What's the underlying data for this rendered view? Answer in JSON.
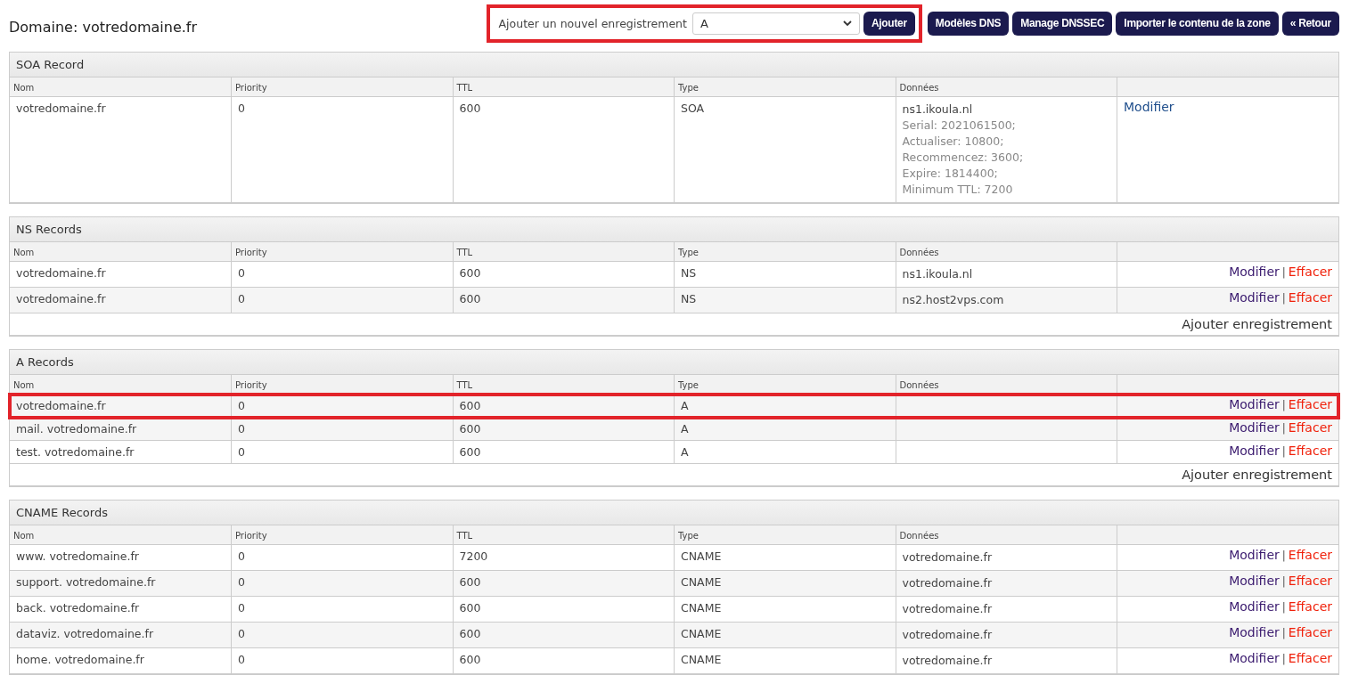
{
  "title": "Domaine: votredomaine.fr",
  "add_record": {
    "label": "Ajouter un nouvel enregistrement",
    "type_value": "A",
    "highlighted": true,
    "button": "Ajouter"
  },
  "buttons": [
    "Modèles DNS",
    "Manage DNSSEC",
    "Importer le contenu de la zone",
    "« Retour"
  ],
  "sections": [
    {
      "title": "SOA Record",
      "columns": [
        "Nom",
        "Priority",
        "TTL",
        "Type",
        "Données"
      ],
      "rows": [
        {
          "cells": [
            "votredomaine.fr",
            "0",
            "600",
            "SOA"
          ],
          "data": [
            "ns1.ikoula.nl",
            "Serial: 2021061500;",
            "Actualiser: 10800;",
            "Recommencez: 3600;",
            "Expire: 1814400;",
            "Minimum TTL: 7200"
          ],
          "highlighted": false,
          "actions": {
            "kind": "edit_only",
            "edit": "Modifier"
          }
        }
      ]
    },
    {
      "title": "NS Records",
      "columns": [
        "Nom",
        "Priority",
        "TTL",
        "Type",
        "Données"
      ],
      "footer_link": "Ajouter enregistrement",
      "rows": [
        {
          "cells": [
            "votredomaine.fr",
            "0",
            "600",
            "NS"
          ],
          "data": [
            "ns1.ikoula.nl"
          ],
          "highlighted": false,
          "actions": {
            "kind": "edit_delete",
            "edit": "Modifier",
            "sep": "|",
            "delete": "Effacer"
          }
        },
        {
          "cells": [
            "votredomaine.fr",
            "0",
            "600",
            "NS"
          ],
          "data": [
            "ns2.host2vps.com"
          ],
          "highlighted": false,
          "actions": {
            "kind": "edit_delete",
            "edit": "Modifier",
            "sep": "|",
            "delete": "Effacer"
          }
        }
      ]
    },
    {
      "title": "A Records",
      "columns": [
        "Nom",
        "Priority",
        "TTL",
        "Type",
        "Données"
      ],
      "footer_link": "Ajouter enregistrement",
      "rows": [
        {
          "cells": [
            "votredomaine.fr",
            "0",
            "600",
            "A"
          ],
          "data": [],
          "highlighted": true,
          "actions": {
            "kind": "edit_delete",
            "edit": "Modifier",
            "sep": "|",
            "delete": "Effacer"
          }
        },
        {
          "cells": [
            "mail. votredomaine.fr",
            "0",
            "600",
            "A"
          ],
          "data": [],
          "highlighted": false,
          "actions": {
            "kind": "edit_delete",
            "edit": "Modifier",
            "sep": "|",
            "delete": "Effacer"
          }
        },
        {
          "cells": [
            "test. votredomaine.fr",
            "0",
            "600",
            "A"
          ],
          "data": [],
          "highlighted": false,
          "actions": {
            "kind": "edit_delete",
            "edit": "Modifier",
            "sep": "|",
            "delete": "Effacer"
          }
        }
      ]
    },
    {
      "title": "CNAME Records",
      "columns": [
        "Nom",
        "Priority",
        "TTL",
        "Type",
        "Données"
      ],
      "rows": [
        {
          "cells": [
            "www. votredomaine.fr",
            "0",
            "7200",
            "CNAME"
          ],
          "data": [
            "votredomaine.fr"
          ],
          "highlighted": false,
          "actions": {
            "kind": "edit_delete",
            "edit": "Modifier",
            "sep": "|",
            "delete": "Effacer"
          }
        },
        {
          "cells": [
            "support. votredomaine.fr",
            "0",
            "600",
            "CNAME"
          ],
          "data": [
            "votredomaine.fr"
          ],
          "highlighted": false,
          "actions": {
            "kind": "edit_delete",
            "edit": "Modifier",
            "sep": "|",
            "delete": "Effacer"
          }
        },
        {
          "cells": [
            "back. votredomaine.fr",
            "0",
            "600",
            "CNAME"
          ],
          "data": [
            "votredomaine.fr"
          ],
          "highlighted": false,
          "actions": {
            "kind": "edit_delete",
            "edit": "Modifier",
            "sep": "|",
            "delete": "Effacer"
          }
        },
        {
          "cells": [
            "dataviz. votredomaine.fr",
            "0",
            "600",
            "CNAME"
          ],
          "data": [
            "votredomaine.fr"
          ],
          "highlighted": false,
          "actions": {
            "kind": "edit_delete",
            "edit": "Modifier",
            "sep": "|",
            "delete": "Effacer"
          }
        },
        {
          "cells": [
            "home. votredomaine.fr",
            "0",
            "600",
            "CNAME"
          ],
          "data": [
            "votredomaine.fr"
          ],
          "highlighted": false,
          "actions": {
            "kind": "edit_delete",
            "edit": "Modifier",
            "sep": "|",
            "delete": "Effacer"
          }
        }
      ]
    }
  ]
}
